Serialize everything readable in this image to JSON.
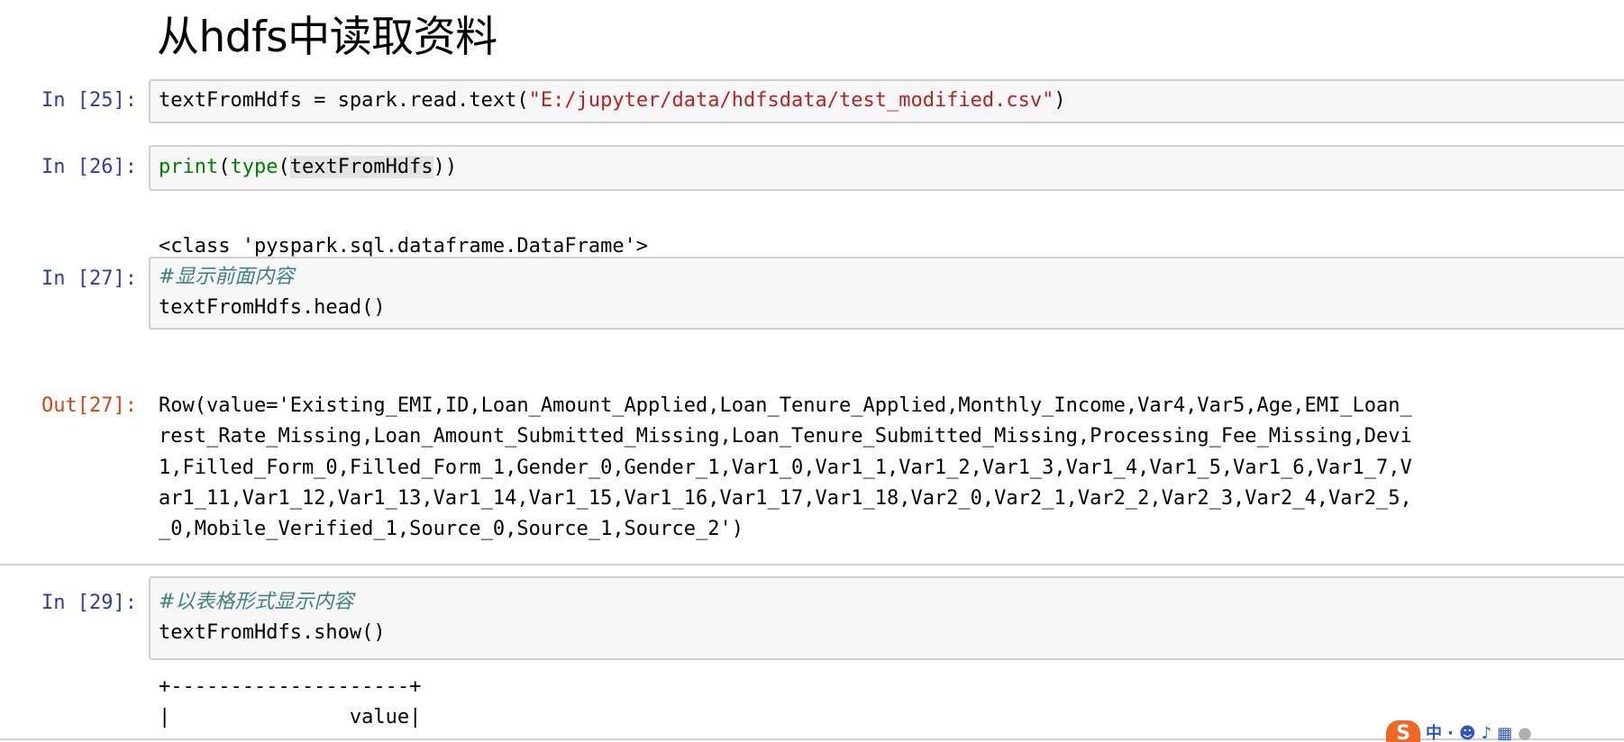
{
  "heading": "从hdfs中读取资料",
  "cells": [
    {
      "prompt": "In [25]:",
      "code": {
        "before": "textFromHdfs = spark.read.text(",
        "string": "\"E:/jupyter/data/hdfsdata/test_modified.csv\"",
        "after": ")"
      }
    },
    {
      "prompt": "In [26]:",
      "code": {
        "fn1": "print",
        "p1": "(",
        "fn2": "type",
        "p2": "(",
        "var": "textFromHdfs",
        "p3": "))"
      },
      "output": "<class 'pyspark.sql.dataframe.DataFrame'>"
    },
    {
      "prompt": "In [27]:",
      "comment": "#显示前面内容",
      "code_line": "textFromHdfs.head()",
      "out_prompt": "Out[27]:",
      "output_lines": [
        "Row(value='Existing_EMI,ID,Loan_Amount_Applied,Loan_Tenure_Applied,Monthly_Income,Var4,Var5,Age,EMI_Loan_",
        "rest_Rate_Missing,Loan_Amount_Submitted_Missing,Loan_Tenure_Submitted_Missing,Processing_Fee_Missing,Devi",
        "1,Filled_Form_0,Filled_Form_1,Gender_0,Gender_1,Var1_0,Var1_1,Var1_2,Var1_3,Var1_4,Var1_5,Var1_6,Var1_7,V",
        "ar1_11,Var1_12,Var1_13,Var1_14,Var1_15,Var1_16,Var1_17,Var1_18,Var2_0,Var2_1,Var2_2,Var2_3,Var2_4,Var2_5,",
        "_0,Mobile_Verified_1,Source_0,Source_1,Source_2')"
      ]
    },
    {
      "prompt": "In [29]:",
      "comment": "#以表格形式显示内容",
      "code_line": "textFromHdfs.show()",
      "output_lines": [
        "+--------------------+",
        "|               value|"
      ]
    }
  ],
  "ime": {
    "logo": "S",
    "items": [
      "中",
      "·",
      "☻",
      "♪",
      "▦",
      "●"
    ]
  },
  "colors": {
    "prompt_in": "#303f9f",
    "prompt_out": "#d84315",
    "string": "#ba2121",
    "builtin": "#008000",
    "comment": "#408080"
  }
}
